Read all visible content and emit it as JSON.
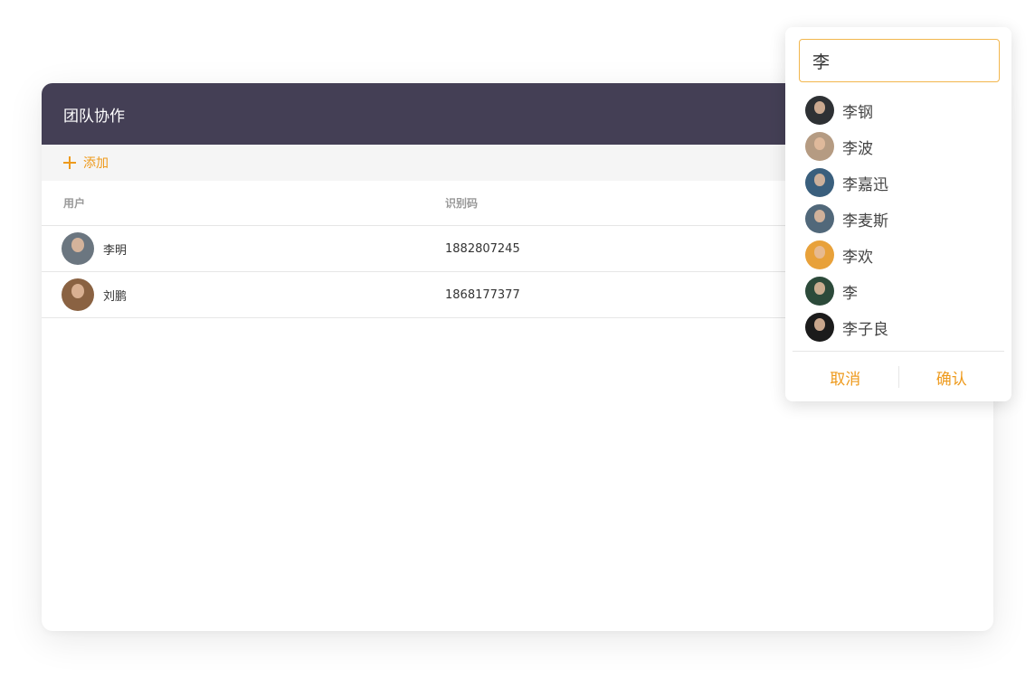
{
  "panel": {
    "title": "团队协作",
    "add_label": "添加",
    "columns": {
      "user": "用户",
      "code": "识别码"
    },
    "rows": [
      {
        "name": "李明",
        "code": "1882807245",
        "avatar_color": "#6b7680"
      },
      {
        "name": "刘鹏",
        "code": "1868177377",
        "avatar_color": "#8a6242"
      }
    ]
  },
  "picker": {
    "search_value": "李",
    "results": [
      {
        "name": "李钢",
        "avatar_color": "#2e3134"
      },
      {
        "name": "李波",
        "avatar_color": "#b59b82"
      },
      {
        "name": "李嘉迅",
        "avatar_color": "#3a5f7d"
      },
      {
        "name": "李麦斯",
        "avatar_color": "#51687a"
      },
      {
        "name": "李欢",
        "avatar_color": "#e8a13a"
      },
      {
        "name": "李",
        "avatar_color": "#2c4a3a"
      },
      {
        "name": "李子良",
        "avatar_color": "#1b1b1b"
      }
    ],
    "cancel_label": "取消",
    "confirm_label": "确认"
  },
  "colors": {
    "header_bg": "#443f55",
    "accent": "#ee9a1c",
    "input_border": "#f2b64d"
  }
}
